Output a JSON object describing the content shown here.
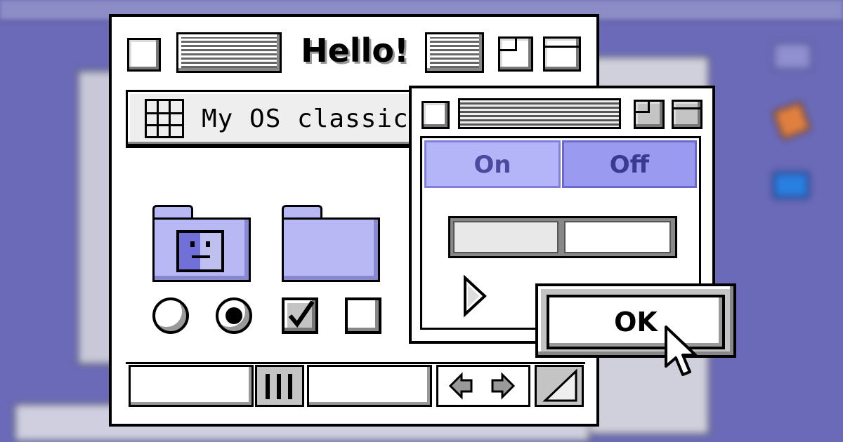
{
  "main_window": {
    "title": "Hello!",
    "location_label": "My OS classic"
  },
  "toggle_window": {
    "segments": [
      {
        "label": "On",
        "selected": true
      },
      {
        "label": "Off",
        "selected": false
      }
    ]
  },
  "dialog": {
    "ok_label": "OK"
  },
  "controls": {
    "radio_1_selected": false,
    "radio_2_selected": true,
    "checkbox_1_checked": true,
    "checkbox_2_checked": false
  },
  "colors": {
    "desktop": "#6a6ab8",
    "accent_lavender": "#a8a8f0",
    "folder": "#b8b8f4"
  },
  "icons": [
    "close-box-icon",
    "zoom-box-icon",
    "collapse-box-icon",
    "grid-icon",
    "system-folder-icon",
    "folder-icon",
    "scroll-left-arrow-icon",
    "scroll-right-arrow-icon",
    "resize-grip-icon",
    "disclosure-triangle-icon",
    "pointer-cursor-icon"
  ]
}
